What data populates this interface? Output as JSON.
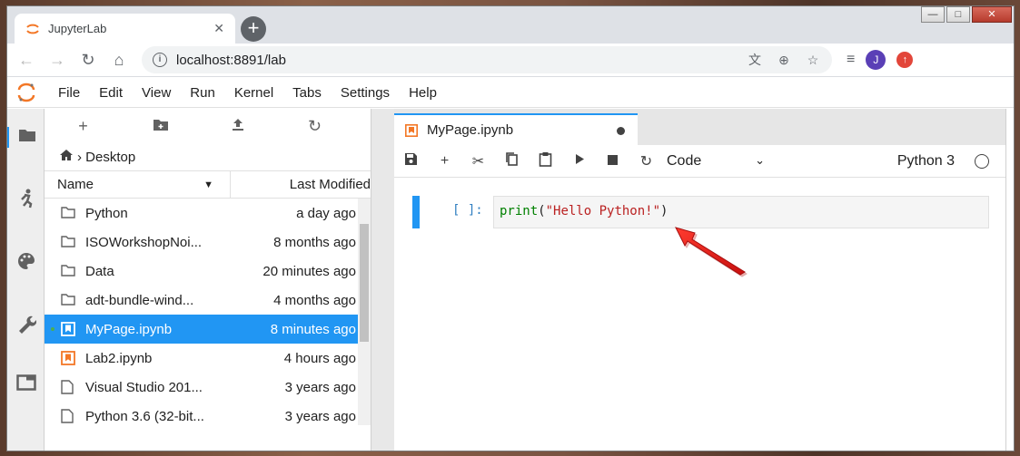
{
  "browser": {
    "tab_title": "JupyterLab",
    "tab_close": "✕",
    "new_tab": "+",
    "url": "localhost:8891/lab",
    "window_controls": [
      "—",
      "□",
      "✕"
    ]
  },
  "menu": [
    "File",
    "Edit",
    "View",
    "Run",
    "Kernel",
    "Tabs",
    "Settings",
    "Help"
  ],
  "profile_initial": "J",
  "file_browser": {
    "breadcrumb": "Desktop",
    "col_name": "Name",
    "col_modified": "Last Modified",
    "files": [
      {
        "name": "Python",
        "modified": "a day ago",
        "type": "folder"
      },
      {
        "name": "ISOWorkshopNoi...",
        "modified": "8 months ago",
        "type": "folder"
      },
      {
        "name": "Data",
        "modified": "20 minutes ago",
        "type": "folder"
      },
      {
        "name": "adt-bundle-wind...",
        "modified": "4 months ago",
        "type": "folder"
      },
      {
        "name": "MyPage.ipynb",
        "modified": "8 minutes ago",
        "type": "notebook",
        "selected": true,
        "running": true
      },
      {
        "name": "Lab2.ipynb",
        "modified": "4 hours ago",
        "type": "notebook"
      },
      {
        "name": "Visual Studio 201...",
        "modified": "3 years ago",
        "type": "file"
      },
      {
        "name": "Python 3.6 (32-bit...",
        "modified": "3 years ago",
        "type": "file"
      }
    ]
  },
  "notebook": {
    "tab_title": "MyPage.ipynb",
    "cell_type": "Code",
    "kernel": "Python 3",
    "cell": {
      "prompt": "[ ]:",
      "code_fn": "print",
      "code_open": "(",
      "code_str": "\"Hello Python!\"",
      "code_close": ")"
    }
  },
  "colors": {
    "accent": "#2196f3",
    "jupyter_orange": "#f37726",
    "arrow_red": "#e8191a"
  }
}
